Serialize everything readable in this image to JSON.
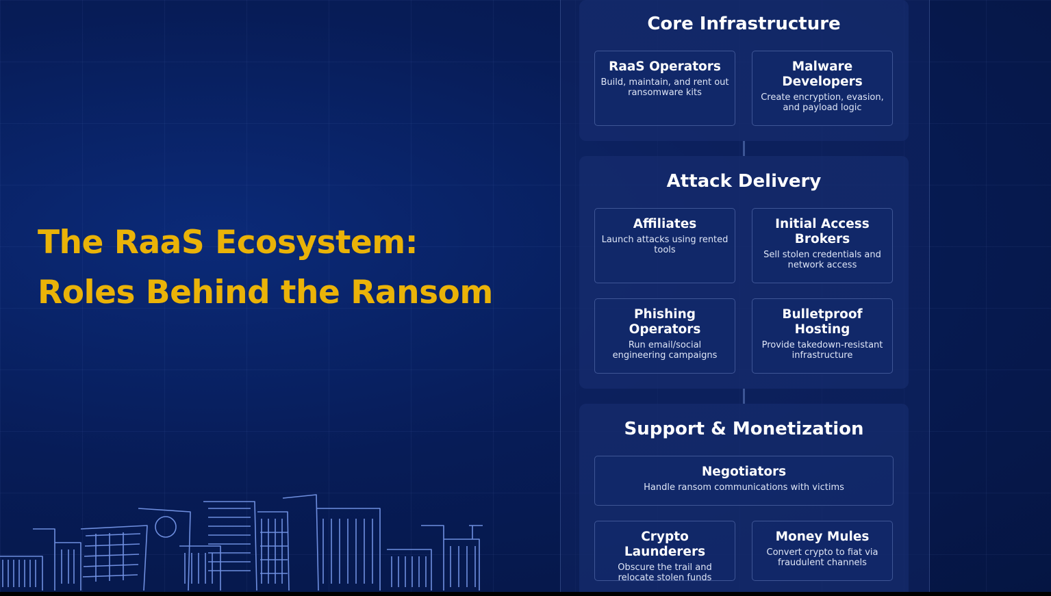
{
  "title": {
    "line1": "The RaaS Ecosystem:",
    "line2": "Roles Behind the Ransom",
    "color": "#eab308"
  },
  "sections": [
    {
      "title": "Core Infrastructure",
      "cards": [
        {
          "title": "RaaS Operators",
          "desc": "Build, maintain, and rent out ransomware kits"
        },
        {
          "title": "Malware Developers",
          "desc": "Create encryption, evasion, and payload logic"
        }
      ]
    },
    {
      "title": "Attack Delivery",
      "cards": [
        {
          "title": "Affiliates",
          "desc": "Launch attacks using rented tools"
        },
        {
          "title": "Initial Access Brokers",
          "desc": "Sell stolen credentials and network access"
        },
        {
          "title": "Phishing Operators",
          "desc": "Run email/social engineering campaigns"
        },
        {
          "title": "Bulletproof Hosting",
          "desc": "Provide takedown-resistant infrastructure"
        }
      ]
    },
    {
      "title": "Support & Monetization",
      "cards": [
        {
          "title": "Negotiators",
          "desc": "Handle ransom communications with victims"
        },
        {
          "title": "Crypto Launderers",
          "desc": "Obscure the trail and relocate stolen funds"
        },
        {
          "title": "Money Mules",
          "desc": "Convert crypto to fiat via fraudulent channels"
        }
      ]
    }
  ],
  "decor": {
    "skyline_icon": "city-skyline-icon"
  }
}
